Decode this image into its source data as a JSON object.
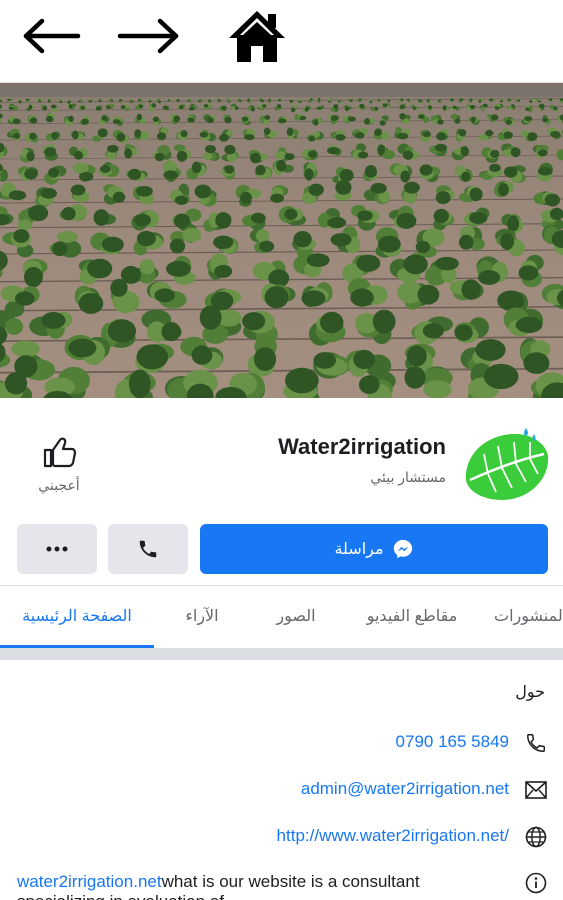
{
  "nav": {
    "back_icon": "arrow-left-icon",
    "forward_icon": "arrow-right-icon",
    "home_icon": "home-icon"
  },
  "cover": {
    "description_icon": "cover-photo"
  },
  "page": {
    "name": "Water2irrigation",
    "category": "مستشار بيئي",
    "like_label": "أعجبني"
  },
  "actions": {
    "message_label": "مراسلة",
    "call_icon": "phone-icon",
    "more_icon": "more-dots-icon"
  },
  "tabs": [
    {
      "label": "الصفحة الرئيسية",
      "active": true
    },
    {
      "label": "الآراء"
    },
    {
      "label": "الصور"
    },
    {
      "label": "مقاطع الفيديو"
    },
    {
      "label": "المنشورات"
    }
  ],
  "about": {
    "title": "حول",
    "phone": "0790 165 5849",
    "email": "admin@water2irrigation.net",
    "website": "http://www.water2irrigation.net/",
    "desc_link": "water2irrigation.net",
    "desc_text": "what  is our website is a consultant  specializing in evaluation of"
  },
  "colors": {
    "accent": "#1877f2",
    "button_gray": "#e4e6eb",
    "separator": "#dadde1"
  }
}
